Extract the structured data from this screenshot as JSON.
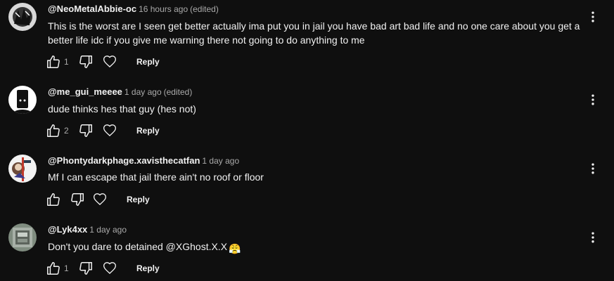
{
  "comments": [
    {
      "author": "@NeoMetalAbbie-oc",
      "time": "16 hours ago",
      "edited": "(edited)",
      "text": "This is the worst are I seen get better actually ima put you in jail you have bad art bad life and no one care about you get a better life idc if you give me warning there not going to do anything to me",
      "likes": "1",
      "reply": "Reply"
    },
    {
      "author": "@me_gui_meeee",
      "time": "1 day ago",
      "edited": "(edited)",
      "text": "dude thinks hes that guy (hes not)",
      "likes": "2",
      "reply": "Reply"
    },
    {
      "author": "@Phontydarkphage.xavisthecatfan",
      "time": "1 day ago",
      "edited": "",
      "text": "Mf I can escape that jail there ain't no roof or floor",
      "likes": "",
      "reply": "Reply"
    },
    {
      "author": "@Lyk4xx",
      "time": "1 day ago",
      "edited": "",
      "text": "Don't you dare to detained @XGhost.X.X",
      "emoji": "😤",
      "likes": "1",
      "reply": "Reply"
    }
  ],
  "colors": {
    "background": "#0f0f0f",
    "text": "#f1f1f1",
    "muted": "#aaaaaa"
  },
  "icons": [
    "like-icon",
    "dislike-icon",
    "heart-icon",
    "more-vert-icon"
  ]
}
